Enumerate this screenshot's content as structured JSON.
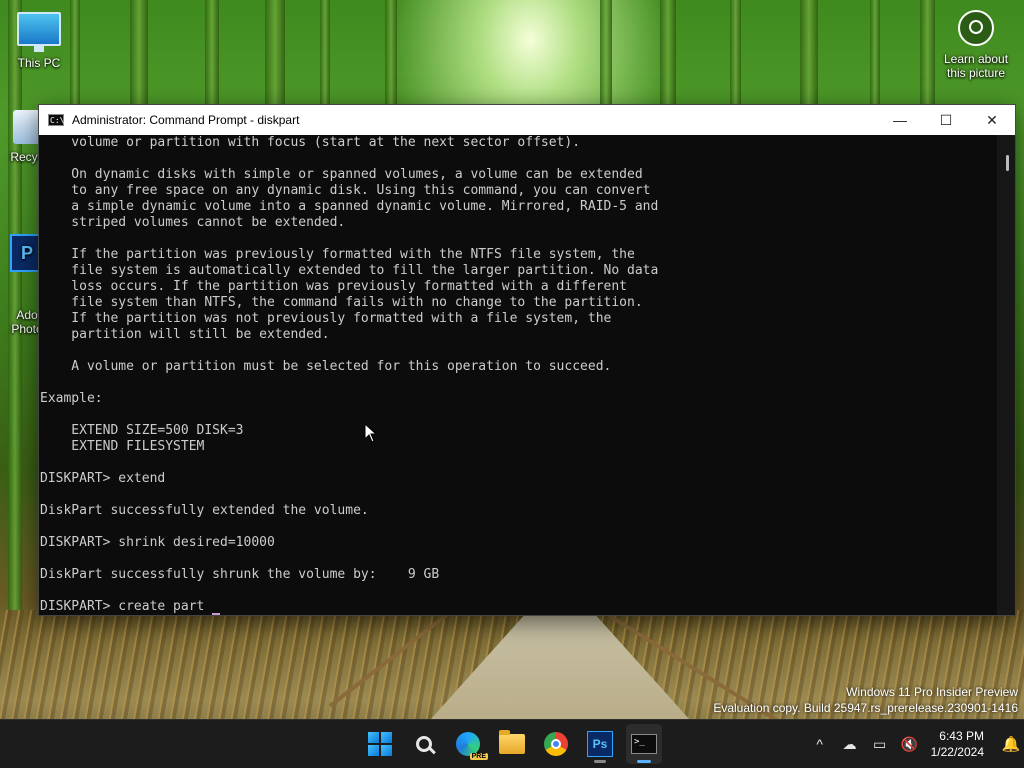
{
  "desktop": {
    "icons": [
      {
        "label": "This PC"
      },
      {
        "label": "Recyc"
      },
      {
        "label": "Ado\nPhoto"
      }
    ],
    "learn_about": "Learn about\nthis picture"
  },
  "window": {
    "title": "Administrator: Command Prompt - diskpart",
    "icon_text": "C:\\",
    "minimize_glyph": "—",
    "maximize_glyph": "☐",
    "close_glyph": "✕"
  },
  "console": {
    "lines": [
      "    volume or partition with focus (start at the next sector offset).",
      "",
      "    On dynamic disks with simple or spanned volumes, a volume can be extended",
      "    to any free space on any dynamic disk. Using this command, you can convert",
      "    a simple dynamic volume into a spanned dynamic volume. Mirrored, RAID-5 and",
      "    striped volumes cannot be extended.",
      "",
      "    If the partition was previously formatted with the NTFS file system, the",
      "    file system is automatically extended to fill the larger partition. No data",
      "    loss occurs. If the partition was previously formatted with a different",
      "    file system than NTFS, the command fails with no change to the partition.",
      "    If the partition was not previously formatted with a file system, the",
      "    partition will still be extended.",
      "",
      "    A volume or partition must be selected for this operation to succeed.",
      "",
      "Example:",
      "",
      "    EXTEND SIZE=500 DISK=3",
      "    EXTEND FILESYSTEM",
      "",
      "DISKPART> extend",
      "",
      "DiskPart successfully extended the volume.",
      "",
      "DISKPART> shrink desired=10000",
      "",
      "DiskPart successfully shrunk the volume by:    9 GB",
      ""
    ],
    "prompt_line": "DISKPART> create part"
  },
  "watermark": {
    "line1": "Windows 11 Pro Insider Preview",
    "line2": "Evaluation copy. Build 25947.rs_prerelease.230901-1416"
  },
  "taskbar": {
    "apps": [
      {
        "name": "start",
        "icon": "windows-start-icon"
      },
      {
        "name": "search",
        "icon": "search-icon"
      },
      {
        "name": "edge-pre",
        "icon": "edge-icon",
        "badge": "PRE"
      },
      {
        "name": "file-explorer",
        "icon": "folder-icon"
      },
      {
        "name": "chrome",
        "icon": "chrome-icon"
      },
      {
        "name": "photoshop",
        "icon": "photoshop-icon",
        "text": "Ps"
      },
      {
        "name": "terminal",
        "icon": "terminal-icon",
        "text": ">_"
      }
    ],
    "tray": {
      "chevron": "^",
      "time": "6:43 PM",
      "date": "1/22/2024"
    }
  },
  "colors": {
    "console_bg": "#0c0c0c",
    "console_text": "#cccccc",
    "taskbar_bg": "#1c1c1c",
    "accent": "#5bb3ff"
  }
}
